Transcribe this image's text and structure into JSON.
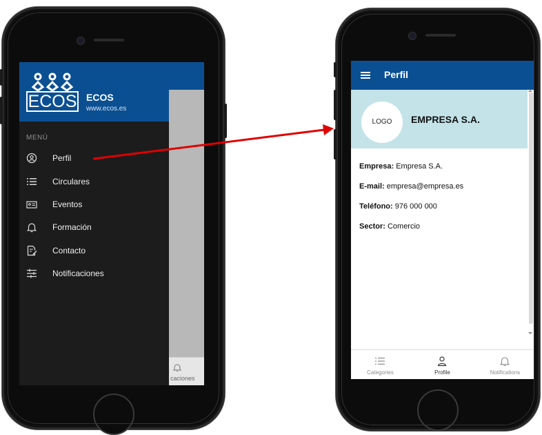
{
  "left_screen": {
    "brand": {
      "name": "ECOS",
      "url": "www.ecos.es",
      "logo_text": "ECOS"
    },
    "menu_title": "MENÚ",
    "menu_items": [
      {
        "label": "Perfil",
        "icon": "person-circle-icon"
      },
      {
        "label": "Circulares",
        "icon": "list-icon"
      },
      {
        "label": "Eventos",
        "icon": "id-card-icon"
      },
      {
        "label": "Formación",
        "icon": "bell-icon"
      },
      {
        "label": "Contacto",
        "icon": "document-edit-icon"
      },
      {
        "label": "Notificaciones",
        "icon": "sliders-icon"
      }
    ],
    "behind_tab_label": "caciones"
  },
  "right_screen": {
    "header": {
      "title": "Perfil",
      "menu_icon": "hamburger-icon"
    },
    "profile": {
      "logo_text": "LOGO",
      "company_name": "EMPRESA S.A.",
      "fields": [
        {
          "key": "Empresa:",
          "value": "Empresa S.A."
        },
        {
          "key": "E-mail:",
          "value": "empresa@empresa.es"
        },
        {
          "key": "Teléfono:",
          "value": "976 000 000"
        },
        {
          "key": "Sector:",
          "value": "Comercio"
        }
      ]
    },
    "tabs": [
      {
        "label": "Categories",
        "icon": "list-icon"
      },
      {
        "label": "Profile",
        "icon": "person-icon",
        "active": true
      },
      {
        "label": "Notifications",
        "icon": "bell-icon"
      }
    ]
  },
  "colors": {
    "brand_blue": "#0b4f93",
    "banner": "#c3e3e8",
    "drawer": "#1c1c1c",
    "arrow": "#e00000"
  }
}
